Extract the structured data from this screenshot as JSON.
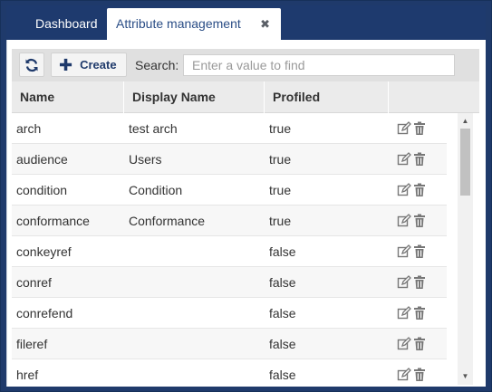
{
  "tabs": [
    {
      "label": "Dashboard"
    },
    {
      "label": "Attribute management"
    }
  ],
  "toolbar": {
    "create_label": "Create",
    "search_label": "Search:",
    "search_placeholder": "Enter a value to find",
    "search_value": ""
  },
  "table": {
    "columns": [
      "Name",
      "Display Name",
      "Profiled",
      ""
    ],
    "rows": [
      {
        "name": "arch",
        "display": "test arch",
        "profiled": "true"
      },
      {
        "name": "audience",
        "display": "Users",
        "profiled": "true"
      },
      {
        "name": "condition",
        "display": "Condition",
        "profiled": "true"
      },
      {
        "name": "conformance",
        "display": "Conformance",
        "profiled": "true"
      },
      {
        "name": "conkeyref",
        "display": "",
        "profiled": "false"
      },
      {
        "name": "conref",
        "display": "",
        "profiled": "false"
      },
      {
        "name": "conrefend",
        "display": "",
        "profiled": "false"
      },
      {
        "name": "fileref",
        "display": "",
        "profiled": "false"
      },
      {
        "name": "href",
        "display": "",
        "profiled": "false"
      }
    ]
  },
  "icons": {
    "refresh": "refresh-icon",
    "create": "plus-icon",
    "close_tab": "close-icon",
    "edit": "edit-icon",
    "delete": "trash-icon"
  },
  "colors": {
    "frame": "#1f3a6b",
    "accent": "#2a4d86",
    "header_bg": "#ebebeb",
    "toolbar_bg": "#e0e0e0"
  }
}
